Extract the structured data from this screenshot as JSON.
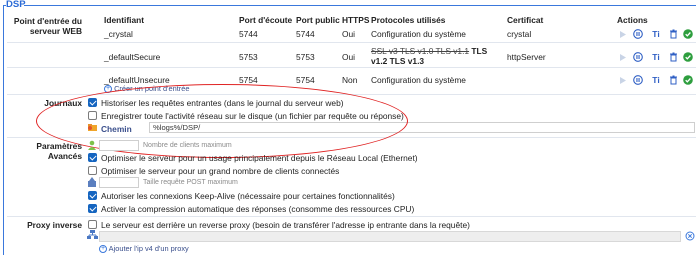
{
  "section": {
    "legend": "DSP"
  },
  "sections": {
    "entry": "Point d'entrée du serveur WEB",
    "journaux": "Journaux",
    "params": "Paramètres Avancés",
    "proxy": "Proxy inverse"
  },
  "table": {
    "headers": [
      "Identifiant",
      "Port d'écoute",
      "Port public",
      "HTTPS",
      "Protocoles utilisés",
      "Certificat",
      "Actions"
    ],
    "rows": [
      {
        "id": "_crystal",
        "port": "5744",
        "public": "5744",
        "https": "Oui",
        "protocols": "Configuration du système",
        "cert": "crystal"
      },
      {
        "id": "_defaultSecure",
        "port": "5753",
        "public": "5753",
        "https": "Oui",
        "protocols_strike": "SSL v3 TLS v1.0 TLS v1.1",
        "protocols_bold1": "TLS",
        "protocols_bold2": "v1.2 TLS v1.3",
        "cert": "httpServer"
      },
      {
        "id": "_defaultUnsecure",
        "port": "5754",
        "public": "5754",
        "https": "Non",
        "protocols": "Configuration du système",
        "cert": ""
      }
    ],
    "create_link": "Créer un point d'entrée",
    "action_ti": "Ti"
  },
  "journaux": {
    "log_requests": {
      "label": "Historiser les requêtes entrantes (dans le journal du serveur web)",
      "checked": true
    },
    "log_network": {
      "label": "Enregistrer toute l'activité réseau sur le disque (un fichier par requête ou réponse)",
      "checked": false
    },
    "path_label": "Chemin",
    "path_value": "%logs%/DSP/"
  },
  "params": {
    "max_clients_placeholder": "Nombre de clients maximum",
    "opt_local": {
      "label": "Optimiser le serveur pour un usage principalement depuis le Réseau Local (Ethernet)",
      "checked": true
    },
    "opt_many": {
      "label": "Optimiser le serveur pour un grand nombre de clients connectés",
      "checked": false
    },
    "post_size_placeholder": "Taille requête POST maximum",
    "keepalive": {
      "label": "Autoriser les connexions Keep-Alive (nécessaire pour certaines fonctionnalités)",
      "checked": true
    },
    "compression": {
      "label": "Activer la compression automatique des réponses (consomme des ressources CPU)",
      "checked": true
    }
  },
  "proxy": {
    "behind": {
      "label": "Le serveur est derrière un reverse proxy (besoin de transférer l'adresse ip entrante dans la requête)",
      "checked": false
    },
    "add_ip": "Ajouter l'ip v4 d'un proxy"
  },
  "colors": {
    "accent": "#1565c0",
    "green": "#2e9e3e",
    "red_annotation": "#e02424",
    "frame": "#3a78dc"
  }
}
